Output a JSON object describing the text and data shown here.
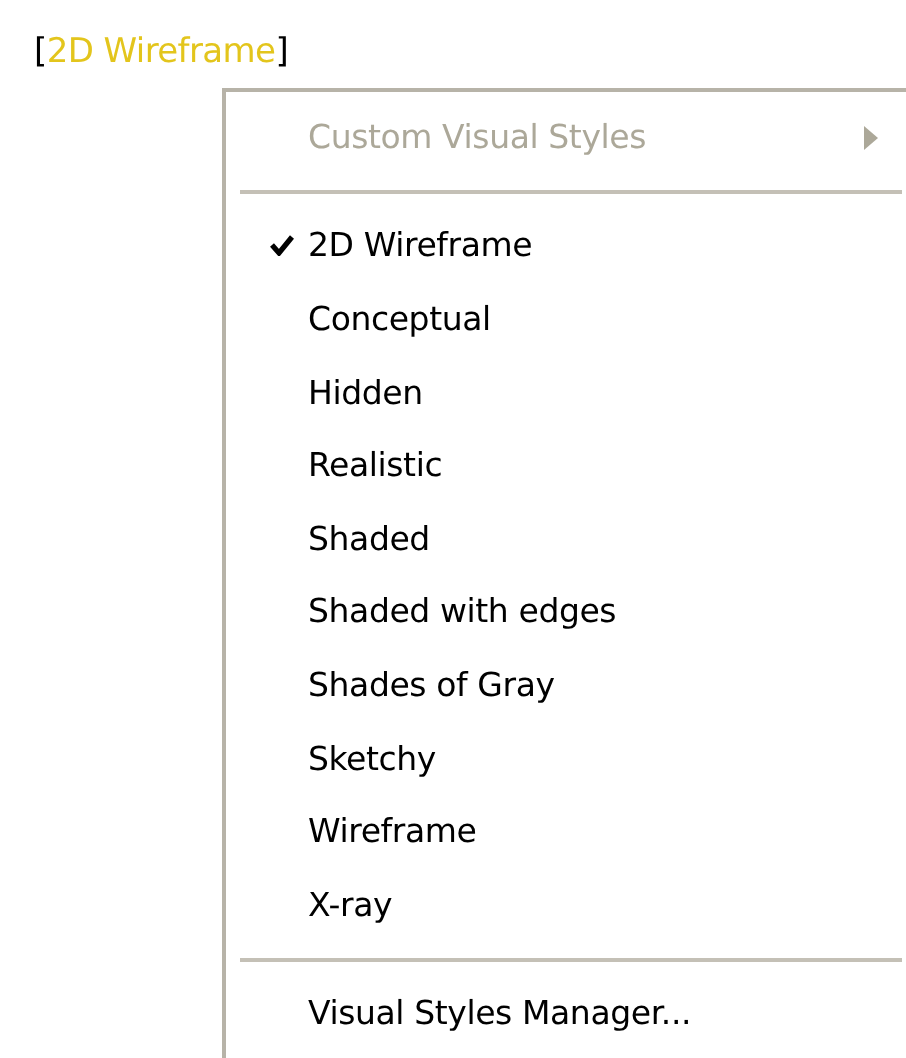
{
  "viewport_control": {
    "open_bracket": "[",
    "label": "2D Wireframe",
    "close_bracket": "]"
  },
  "menu": {
    "items": [
      {
        "kind": "submenu",
        "label": "Custom Visual Styles",
        "disabled": true
      },
      {
        "kind": "separator"
      },
      {
        "kind": "item",
        "label": "2D Wireframe",
        "checked": true
      },
      {
        "kind": "item",
        "label": "Conceptual",
        "checked": false
      },
      {
        "kind": "item",
        "label": "Hidden",
        "checked": false
      },
      {
        "kind": "item",
        "label": "Realistic",
        "checked": false
      },
      {
        "kind": "item",
        "label": "Shaded",
        "checked": false
      },
      {
        "kind": "item",
        "label": "Shaded with edges",
        "checked": false
      },
      {
        "kind": "item",
        "label": "Shades of Gray",
        "checked": false
      },
      {
        "kind": "item",
        "label": "Sketchy",
        "checked": false
      },
      {
        "kind": "item",
        "label": "Wireframe",
        "checked": false
      },
      {
        "kind": "item",
        "label": "X-ray",
        "checked": false
      },
      {
        "kind": "separator"
      },
      {
        "kind": "item",
        "label": "Visual Styles Manager...",
        "checked": false
      }
    ]
  }
}
